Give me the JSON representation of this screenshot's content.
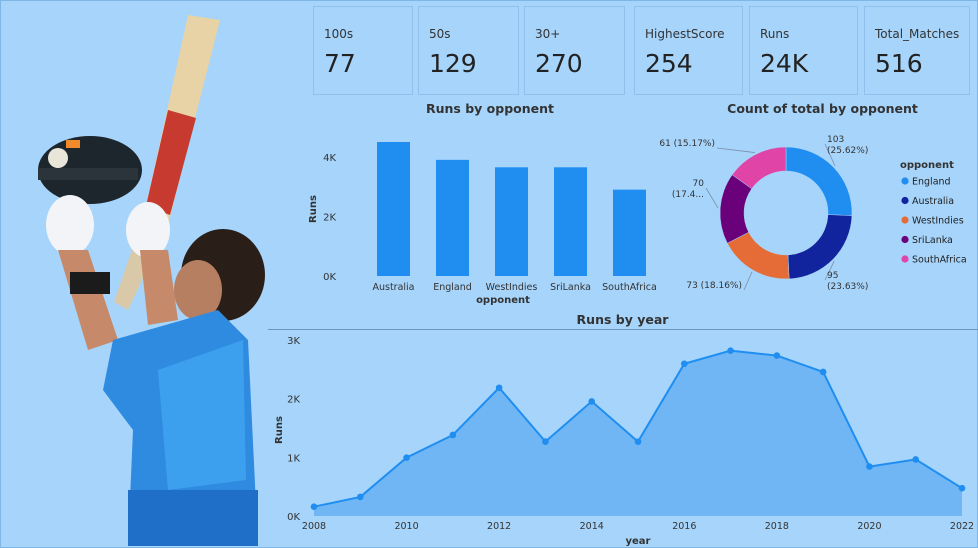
{
  "kpis": [
    {
      "label": "100s",
      "value": "77"
    },
    {
      "label": "50s",
      "value": "129"
    },
    {
      "label": "30+",
      "value": "270"
    },
    {
      "label": "HighestScore",
      "value": "254"
    },
    {
      "label": "Runs",
      "value": "24K"
    },
    {
      "label": "Total_Matches",
      "value": "516"
    }
  ],
  "colors": {
    "background": "#a6d4fb",
    "bar": "#1f8ef0",
    "area_fill": "#66b0f2",
    "line": "#1f8ef0"
  },
  "player_image": {
    "icon": "cricketer-celebrating-photo"
  },
  "chart_data": [
    {
      "type": "bar",
      "title": "Runs by opponent",
      "xlabel": "opponent",
      "ylabel": "Runs",
      "categories": [
        "Australia",
        "England",
        "WestIndies",
        "SriLanka",
        "SouthAfrica"
      ],
      "values": [
        4500,
        3900,
        3650,
        3650,
        2900
      ],
      "yticks": [
        "0K",
        "2K",
        "4K"
      ],
      "ylim": [
        0,
        4500
      ]
    },
    {
      "type": "pie",
      "title": "Count of total by opponent",
      "legend_title": "opponent",
      "legend_position": "right",
      "labels": [
        "England",
        "Australia",
        "WestIndies",
        "SriLanka",
        "SouthAfrica"
      ],
      "values": [
        103,
        95,
        73,
        70,
        61
      ],
      "percent_labels": [
        "(25.62%)",
        "(23.63%)",
        "(18.16%)",
        "(17.4...",
        "(15.17%)"
      ],
      "colors": [
        "#1f8ef0",
        "#12239e",
        "#e66c37",
        "#6b007b",
        "#e044a7"
      ]
    },
    {
      "type": "area",
      "title": "Runs by year",
      "xlabel": "year",
      "ylabel": "Runs",
      "x": [
        2008,
        2009,
        2010,
        2011,
        2012,
        2013,
        2014,
        2015,
        2016,
        2017,
        2018,
        2019,
        2020,
        2021,
        2022
      ],
      "values": [
        159,
        325,
        995,
        1381,
        2186,
        1268,
        1953,
        1267,
        2595,
        2818,
        2735,
        2455,
        842,
        964,
        474
      ],
      "xticks": [
        "2008",
        "2010",
        "2012",
        "2014",
        "2016",
        "2018",
        "2020",
        "2022"
      ],
      "yticks": [
        "0K",
        "1K",
        "2K",
        "3K"
      ],
      "ylim": [
        0,
        3000
      ]
    }
  ]
}
